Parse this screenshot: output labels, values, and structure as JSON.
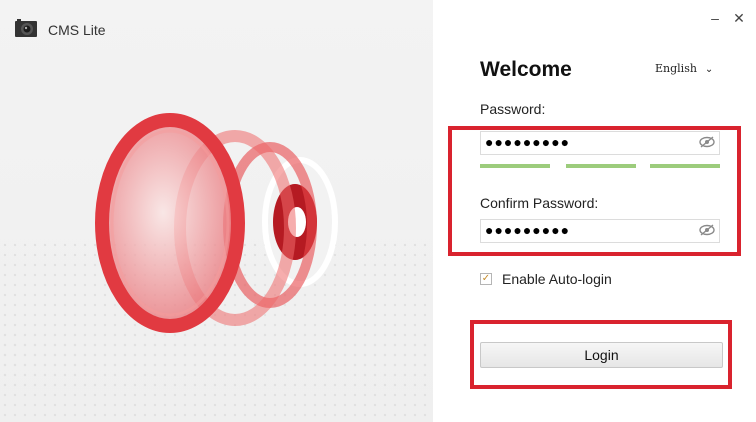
{
  "app": {
    "title": "CMS Lite",
    "icon": "camera-icon"
  },
  "window": {
    "minimize_label": "–",
    "close_label": "✕"
  },
  "login": {
    "welcome": "Welcome",
    "language": "English",
    "password_label": "Password:",
    "password_value": "●●●●●●●●●",
    "confirm_label": "Confirm Password:",
    "confirm_value": "●●●●●●●●●",
    "auto_login_label": "Enable Auto-login",
    "auto_login_checked": true,
    "login_button": "Login"
  },
  "colors": {
    "highlight": "#d9232e",
    "strength": "#9ccc7c",
    "brand_red": "#e8474b"
  }
}
